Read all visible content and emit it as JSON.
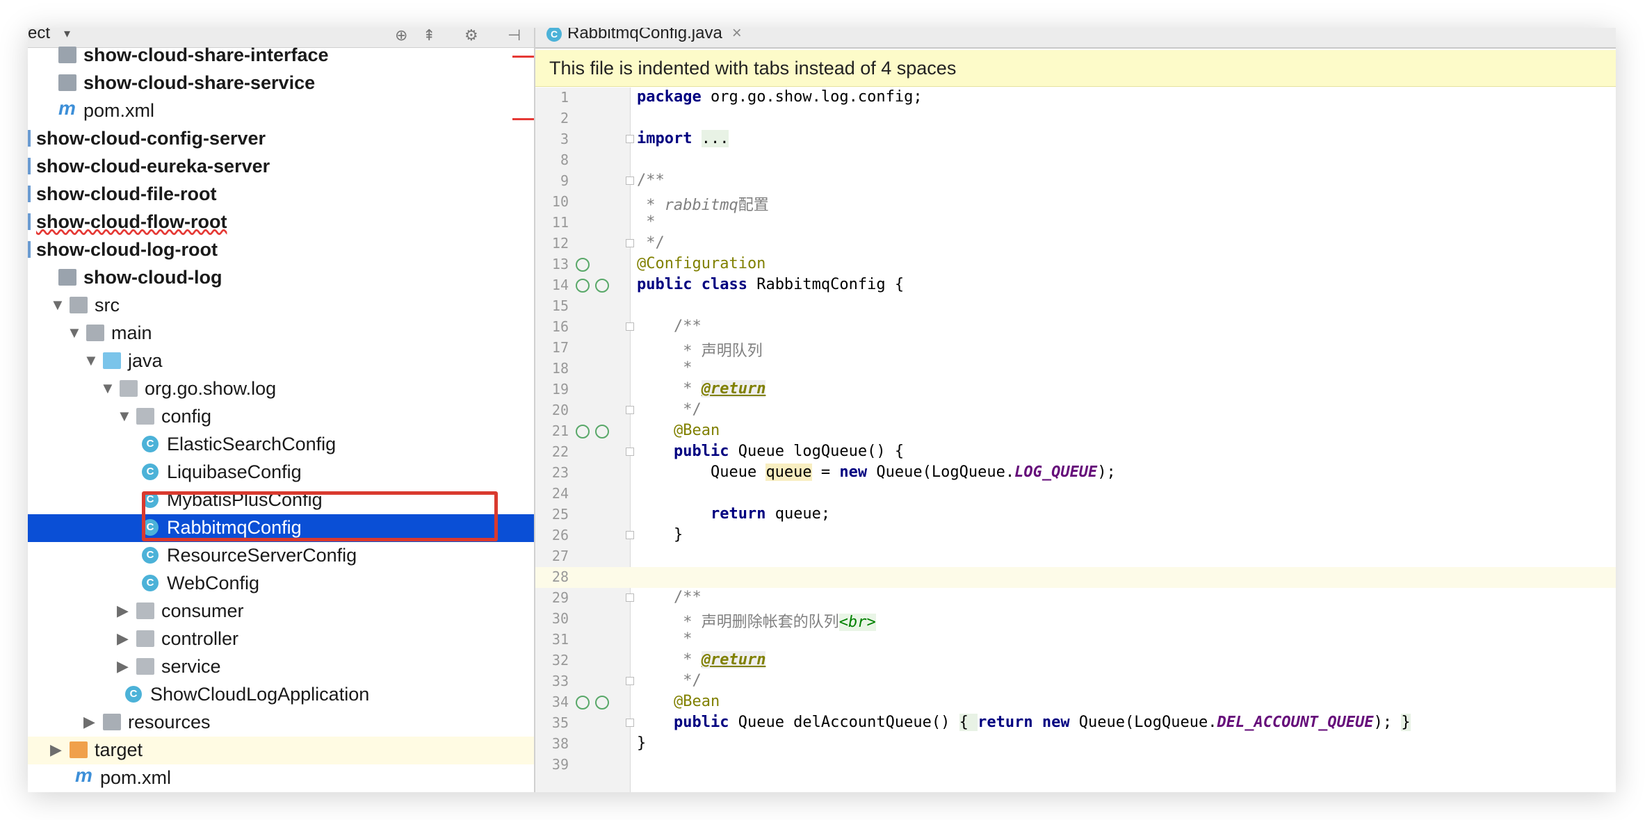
{
  "project": {
    "title": "ect",
    "items": [
      {
        "label": "show-cloud-share-interface",
        "bold": true,
        "indent": 1,
        "icon": "module",
        "y": 0
      },
      {
        "label": "show-cloud-share-service",
        "bold": true,
        "indent": 1,
        "icon": "module",
        "y": 1
      },
      {
        "label": "pom.xml",
        "bold": false,
        "indent": 1,
        "icon": "maven",
        "y": 2
      },
      {
        "label": "show-cloud-config-server",
        "bold": true,
        "indent": 0,
        "icon": "bar",
        "y": 3
      },
      {
        "label": "show-cloud-eureka-server",
        "bold": true,
        "indent": 0,
        "icon": "bar",
        "y": 4
      },
      {
        "label": "show-cloud-file-root",
        "bold": true,
        "indent": 0,
        "icon": "bar",
        "y": 5
      },
      {
        "label": "show-cloud-flow-root",
        "bold": true,
        "indent": 0,
        "icon": "bar",
        "y": 6,
        "squiggle": true
      },
      {
        "label": "show-cloud-log-root",
        "bold": true,
        "indent": 0,
        "icon": "bar",
        "y": 7
      },
      {
        "label": "show-cloud-log",
        "bold": true,
        "indent": 1,
        "icon": "module",
        "y": 8
      },
      {
        "label": "src",
        "bold": false,
        "indent": 1,
        "icon": "folder",
        "arrow": "down",
        "y": 9
      },
      {
        "label": "main",
        "bold": false,
        "indent": 2,
        "icon": "folder",
        "arrow": "down",
        "y": 10
      },
      {
        "label": "java",
        "bold": false,
        "indent": 3,
        "icon": "folder-blue",
        "arrow": "down",
        "y": 11
      },
      {
        "label": "org.go.show.log",
        "bold": false,
        "indent": 4,
        "icon": "package",
        "arrow": "down",
        "y": 12
      },
      {
        "label": "config",
        "bold": false,
        "indent": 5,
        "icon": "package",
        "arrow": "down",
        "y": 13
      },
      {
        "label": "ElasticSearchConfig",
        "bold": false,
        "indent": 6,
        "icon": "class",
        "y": 14
      },
      {
        "label": "LiquibaseConfig",
        "bold": false,
        "indent": 6,
        "icon": "class",
        "y": 15
      },
      {
        "label": "MybatisPlusConfig",
        "bold": false,
        "indent": 6,
        "icon": "class",
        "y": 16
      },
      {
        "label": "RabbitmqConfig",
        "bold": false,
        "indent": 6,
        "icon": "class",
        "y": 17,
        "selected": true
      },
      {
        "label": "ResourceServerConfig",
        "bold": false,
        "indent": 6,
        "icon": "class",
        "y": 18
      },
      {
        "label": "WebConfig",
        "bold": false,
        "indent": 6,
        "icon": "class",
        "y": 19
      },
      {
        "label": "consumer",
        "bold": false,
        "indent": 5,
        "icon": "package",
        "arrow": "right",
        "y": 20
      },
      {
        "label": "controller",
        "bold": false,
        "indent": 5,
        "icon": "package",
        "arrow": "right",
        "y": 21
      },
      {
        "label": "service",
        "bold": false,
        "indent": 5,
        "icon": "package",
        "arrow": "right",
        "y": 22
      },
      {
        "label": "ShowCloudLogApplication",
        "bold": false,
        "indent": 5,
        "icon": "app-class",
        "y": 23
      },
      {
        "label": "resources",
        "bold": false,
        "indent": 3,
        "icon": "folder",
        "arrow": "right",
        "y": 24
      },
      {
        "label": "target",
        "bold": false,
        "indent": 1,
        "icon": "folder-orange",
        "arrow": "right",
        "y": 25,
        "target": true
      },
      {
        "label": "pom.xml",
        "bold": false,
        "indent": 2,
        "icon": "maven",
        "y": 26
      }
    ]
  },
  "editor": {
    "tab_label": "RabbitmqConfig.java",
    "tab_close": "×",
    "banner": "This file is indented with tabs instead of 4 spaces",
    "lines": [
      {
        "n": "1",
        "html": "<span class=\"kw\">package</span> org.go.show.log.config;"
      },
      {
        "n": "2",
        "html": ""
      },
      {
        "n": "3",
        "html": "<span class=\"kw\">import</span> <span class=\"fold\">...</span>",
        "fold": true
      },
      {
        "n": "8",
        "html": ""
      },
      {
        "n": "9",
        "html": "<span class=\"cmn\">/**</span>",
        "fold": true
      },
      {
        "n": "10",
        "html": "<span class=\"cmn\"> * </span><span class=\"cm\">rabbitmq</span><span class=\"cmn\">配置</span>"
      },
      {
        "n": "11",
        "html": "<span class=\"cmn\"> *</span>"
      },
      {
        "n": "12",
        "html": "<span class=\"cmn\"> */</span>",
        "fold": true
      },
      {
        "n": "13",
        "html": "<span class=\"an\">@Configuration</span>",
        "gicons": 1
      },
      {
        "n": "14",
        "html": "<span class=\"kw\">public class</span> RabbitmqConfig {",
        "gicons": 2
      },
      {
        "n": "15",
        "html": ""
      },
      {
        "n": "16",
        "html": "    <span class=\"cmn\">/**</span>",
        "fold": true
      },
      {
        "n": "17",
        "html": "<span class=\"cmn\">     * 声明队列</span>"
      },
      {
        "n": "18",
        "html": "<span class=\"cmn\">     *</span>"
      },
      {
        "n": "19",
        "html": "<span class=\"cmn\">     * </span><span class=\"tag\">@return</span>"
      },
      {
        "n": "20",
        "html": "<span class=\"cmn\">     */</span>",
        "fold": true
      },
      {
        "n": "21",
        "html": "    <span class=\"an\">@Bean</span>",
        "gicons": 2
      },
      {
        "n": "22",
        "html": "    <span class=\"kw\">public</span> Queue logQueue() {",
        "fold": true
      },
      {
        "n": "23",
        "html": "        Queue <span class=\"hl\">queue</span> = <span class=\"kw\">new</span> Queue(LogQueue.<span class=\"st\">LOG_QUEUE</span>);"
      },
      {
        "n": "24",
        "html": ""
      },
      {
        "n": "25",
        "html": "        <span class=\"kw\">return</span> queue;"
      },
      {
        "n": "26",
        "html": "    }",
        "fold": true
      },
      {
        "n": "27",
        "html": ""
      },
      {
        "n": "28",
        "html": "",
        "current": true
      },
      {
        "n": "29",
        "html": "    <span class=\"cmn\">/**</span>",
        "fold": true
      },
      {
        "n": "30",
        "html": "<span class=\"cmn\">     * 声明删除帐套的队列</span><span class=\"brtag\">&lt;br&gt;</span>"
      },
      {
        "n": "31",
        "html": "<span class=\"cmn\">     *</span>"
      },
      {
        "n": "32",
        "html": "<span class=\"cmn\">     * </span><span class=\"tag\">@return</span>"
      },
      {
        "n": "33",
        "html": "<span class=\"cmn\">     */</span>",
        "fold": true
      },
      {
        "n": "34",
        "html": "    <span class=\"an\">@Bean</span>",
        "gicons": 2
      },
      {
        "n": "35",
        "html": "    <span class=\"kw\">public</span> Queue delAccountQueue() <span class=\"fold\">{ </span><span class=\"kw\">return new</span> Queue(LogQueue.<span class=\"st\">DEL_ACCOUNT_QUEUE</span>); <span class=\"fold\">}</span>",
        "fold": true
      },
      {
        "n": "38",
        "html": "}"
      },
      {
        "n": "39",
        "html": ""
      }
    ]
  }
}
